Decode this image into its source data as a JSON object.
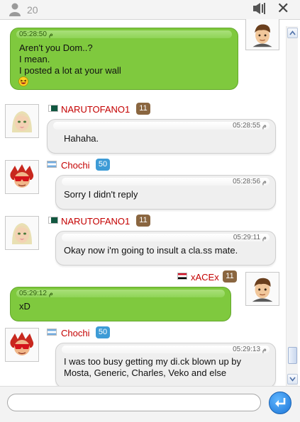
{
  "header": {
    "online_count": "20"
  },
  "messages": [
    {
      "side": "right",
      "time": "05:28:50 م",
      "lines": [
        "Aren't you Dom..?",
        "I mean.",
        "I posted a lot at your wall"
      ],
      "emoji": "laughing-emoji"
    },
    {
      "side": "left",
      "username": "NARUTOFANO1",
      "level": "11",
      "flag": "pakistan-flag",
      "time": "05:28:55 م",
      "lines": [
        "Hahaha."
      ]
    },
    {
      "side": "left",
      "username": "Chochi",
      "level": "50",
      "flag": "argentina-flag",
      "time": "05:28:56 م",
      "lines": [
        "Sorry I didn't reply"
      ]
    },
    {
      "side": "left",
      "username": "NARUTOFANO1",
      "level": "11",
      "flag": "pakistan-flag",
      "time": "05:29:11 م",
      "lines": [
        "Okay now i'm going to insult a cla.ss mate."
      ]
    },
    {
      "side": "right",
      "username": "xACEx",
      "level": "11",
      "flag": "egypt-flag",
      "time": "05:29:12 م",
      "lines": [
        "xD"
      ]
    },
    {
      "side": "left",
      "username": "Chochi",
      "level": "50",
      "flag": "argentina-flag",
      "time": "05:29:13 م",
      "lines": [
        "I was too busy getting my di.ck blown up by",
        "Mosta, Generic, Charles, Veko and else"
      ]
    }
  ],
  "input": {
    "value": "",
    "placeholder": ""
  },
  "colors": {
    "own_bubble": "#7fc93e",
    "other_bubble": "#efefef",
    "username": "#c40000",
    "level_brown": "#8a6640",
    "level_blue": "#3d9bd6",
    "send_button": "#1d75d6"
  }
}
